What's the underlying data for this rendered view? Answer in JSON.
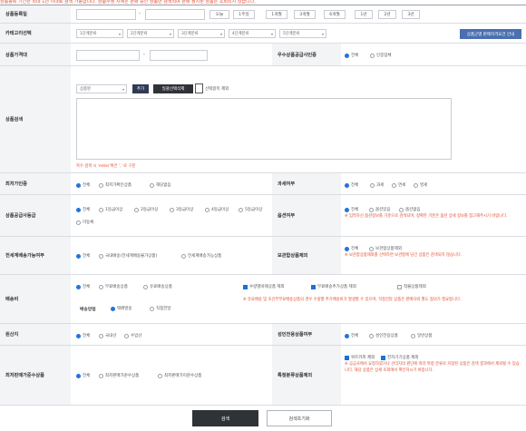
{
  "top_note": "상품등록 기간은 최대 1년 이내로 검색 가능합니다. 상품수정 시에는 판매 중인 상품만 검색되며 판매 정지된 상품은 조회되지 않습니다.",
  "labels": {
    "reg_date": "상품등록일",
    "category": "카테고리선택",
    "price_range": "상품가격대",
    "good_supplier": "우수상품공급사인증",
    "product_search": "상품검색",
    "min_price_cert": "최저가인증",
    "tax": "과세여부",
    "supplier_grade": "상품공급사등급",
    "option": "옵션여부",
    "delivery": "전세계배송가능여부",
    "insurance": "보관합상품제외",
    "shipping_fee": "배송비",
    "shipping_method": "배송방법",
    "origin": "원산지",
    "adult": "성인전용상품여부",
    "min_sale_price": "최저판매가준수상품",
    "special_exclude": "특정분류상품제외"
  },
  "date_buttons": [
    "오늘",
    "1주일",
    "1개월",
    "3개월",
    "6개월",
    "1년",
    "2년",
    "3년"
  ],
  "range_sep": "-",
  "category_selects": [
    "1단계분류",
    "2단계분류",
    "3단계분류",
    "4단계분류",
    "5단계분류"
  ],
  "category_guide_button": "상품군별 판매자격요건 안내",
  "good_supplier_options": [
    "전체",
    "인증업체"
  ],
  "search": {
    "type_select": "상품명",
    "add_button": "추가",
    "bulk_delete_button": "일괄선택삭제",
    "checkbox_label": "선택항목 제외",
    "note": "복수 검색 시 'enter'혹은 ',' 로 구분"
  },
  "min_price_options": [
    "전체",
    "최저가확인상품",
    "해당없음"
  ],
  "tax_options": [
    "전체",
    "과세",
    "면세",
    "영세"
  ],
  "grade_options": [
    "전체",
    "1등급이상",
    "2등급이상",
    "3등급이상",
    "4등급이상",
    "5등급이상",
    "미등록"
  ],
  "option_options": [
    "전체",
    "옵션있음",
    "옵션없음"
  ],
  "option_note": "※ 입력하신 옵션정보를 기준으로 검색되며, 정확한 기준은 옵션 상세 정보를 참고해주시기 바랍니다.",
  "delivery_options": [
    "전체",
    "국내배송(전세계배송불가상품)",
    "전세계배송가능상품"
  ],
  "insurance_options": [
    "전체",
    "보관합상품제외"
  ],
  "insurance_note": "※ 보관합상품제외를 선택하면 보관합에 담긴 상품은 검색되지 않습니다.",
  "shipping_fee_options": [
    "전체",
    "무료배송상품",
    "유료배송상품"
  ],
  "shipping_fee_checks": [
    "수량별비례상품 제외",
    "무료배송추가상품 제외",
    "착불상품제외"
  ],
  "shipping_method_options": [
    "택배발송",
    "직접전달"
  ],
  "shipping_note": "※ 유료배송 및 조건부무료배송상품의 경우 수량별 추가배송비가 발생할 수 있으며, 직접전달 상품은 판매자와 별도 협의가 필요합니다.",
  "origin_options": [
    "전체",
    "국내산",
    "수입산"
  ],
  "adult_options": [
    "전체",
    "성인전용상품",
    "일반상품"
  ],
  "min_sale_options": [
    "전체",
    "최저판매가준수상품",
    "최저판매가미준수상품"
  ],
  "special_checks": [
    "위트카피 제외",
    "전자기기상품 제외"
  ],
  "special_note": "※ 공급사에서 요청하였거나 관리자의 판단에 따라 특정 분류로 지정된 상품은 검색 결과에서 제외될 수 있습니다. 해당 상품은 상세 조회에서 확인하시기 바랍니다.",
  "footer": {
    "search_button": "검색",
    "reset_button": "검색초기화"
  },
  "colors": {
    "accent": "#1e6fd9",
    "note_red": "#e04a2e",
    "dark_button": "#2f3338"
  }
}
